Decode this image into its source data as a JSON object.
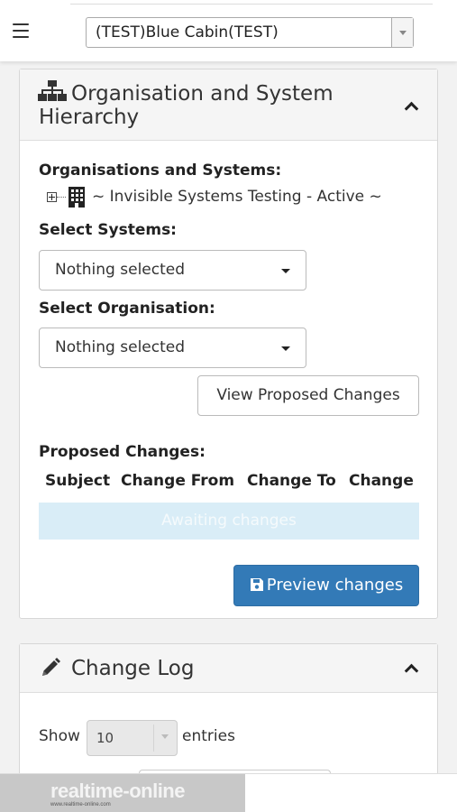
{
  "header": {
    "menu_icon": "hamburger-menu-icon",
    "site_selector_value": "(TEST)Blue Cabin(TEST)"
  },
  "hierarchy_panel": {
    "icon": "sitemap-icon",
    "title": "Organisation and System Hierarchy",
    "orgs_label": "Organisations and Systems:",
    "tree_item": "~ Invisible Systems Testing - Active ~",
    "select_systems_label": "Select Systems:",
    "select_systems_value": "Nothing selected",
    "select_org_label": "Select Organisation:",
    "select_org_value": "Nothing selected",
    "view_changes_button": "View Proposed Changes",
    "proposed_label": "Proposed Changes:",
    "columns": [
      "Subject",
      "Change From",
      "Change To",
      "Change"
    ],
    "awaiting_text": "Awaiting changes",
    "preview_button": "Preview changes"
  },
  "changelog_panel": {
    "icon": "pencil-icon",
    "title": "Change Log",
    "show_label": "Show",
    "entries_value": "10",
    "entries_label": "entries"
  },
  "footer": {
    "logo_text": "realtime-online",
    "logo_subtext": "www.realtime-online.com"
  },
  "colors": {
    "primary": "#337ab7",
    "awaiting_bg": "#d9edf7"
  }
}
